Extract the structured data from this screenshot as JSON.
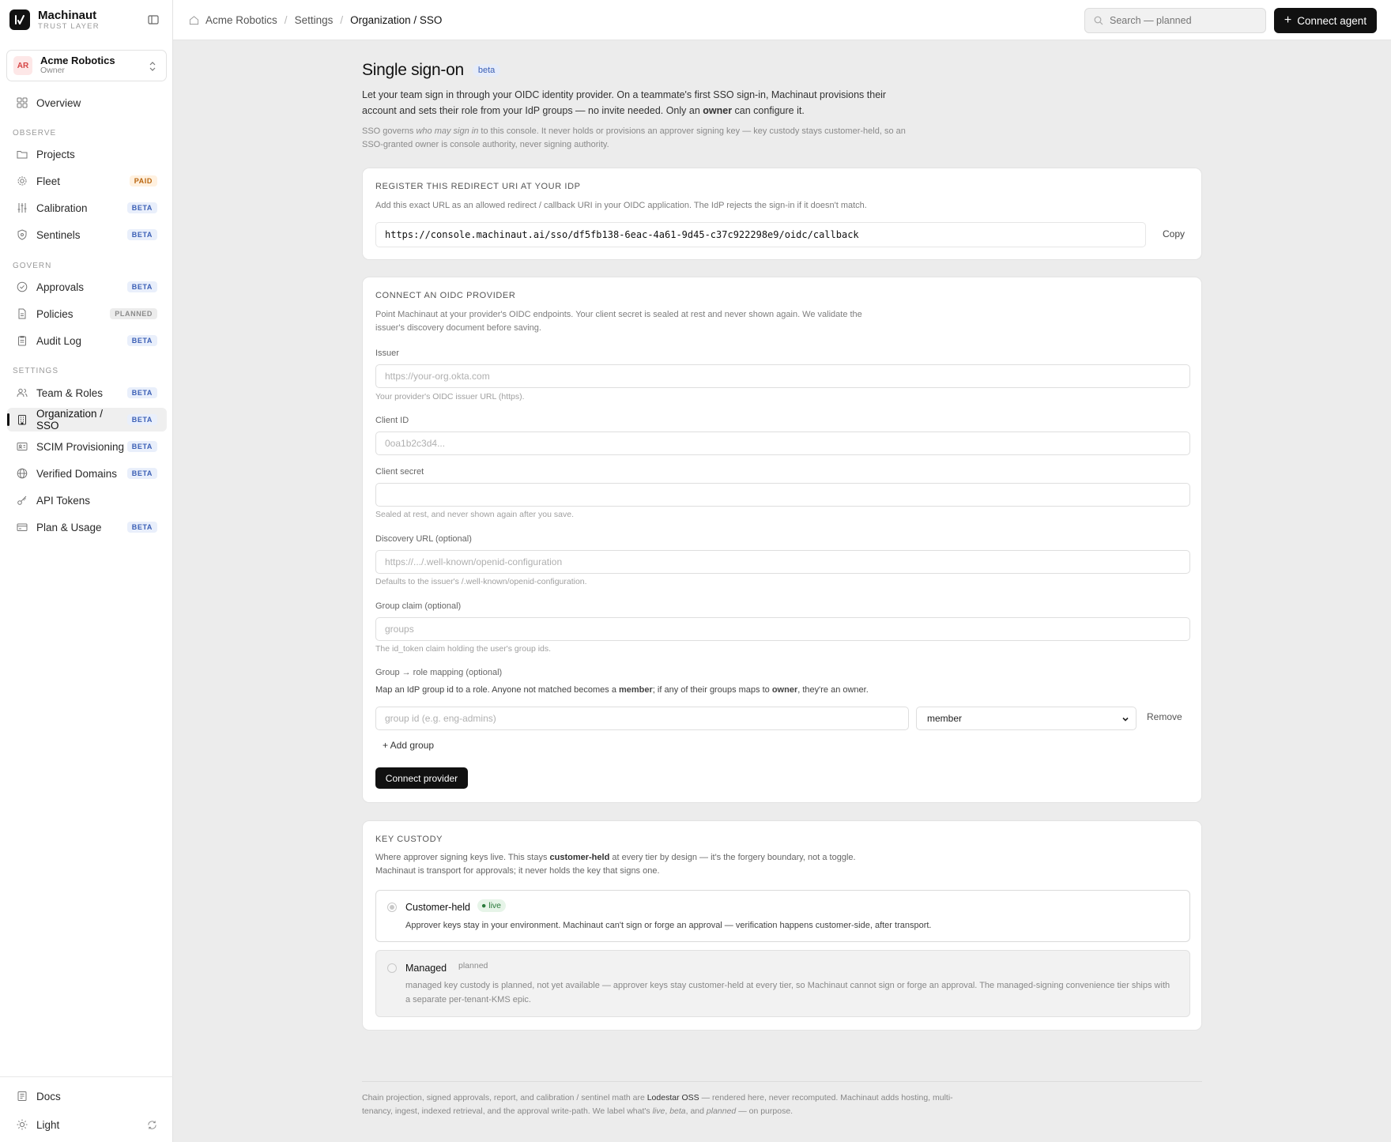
{
  "brand": {
    "name": "Machinaut",
    "sub": "TRUST LAYER"
  },
  "org": {
    "initials": "AR",
    "name": "Acme Robotics",
    "role": "Owner"
  },
  "nav": {
    "overview": "Overview",
    "observe_label": "OBSERVE",
    "observe": [
      {
        "label": "Projects",
        "badge": ""
      },
      {
        "label": "Fleet",
        "badge": "PAID"
      },
      {
        "label": "Calibration",
        "badge": "BETA"
      },
      {
        "label": "Sentinels",
        "badge": "BETA"
      }
    ],
    "govern_label": "GOVERN",
    "govern": [
      {
        "label": "Approvals",
        "badge": "BETA"
      },
      {
        "label": "Policies",
        "badge": "PLANNED"
      },
      {
        "label": "Audit Log",
        "badge": "BETA"
      }
    ],
    "settings_label": "SETTINGS",
    "settings": [
      {
        "label": "Team & Roles",
        "badge": "BETA"
      },
      {
        "label": "Organization / SSO",
        "badge": "BETA"
      },
      {
        "label": "SCIM Provisioning",
        "badge": "BETA"
      },
      {
        "label": "Verified Domains",
        "badge": "BETA"
      },
      {
        "label": "API Tokens",
        "badge": ""
      },
      {
        "label": "Plan & Usage",
        "badge": "BETA"
      }
    ],
    "docs": "Docs",
    "theme": "Light"
  },
  "breadcrumb": [
    "Acme Robotics",
    "Settings",
    "Organization / SSO"
  ],
  "search": {
    "placeholder": "Search — planned"
  },
  "connect_agent": "Connect agent",
  "page": {
    "title": "Single sign-on",
    "beta": "beta",
    "intro_a": "Let your team sign in through your OIDC identity provider. On a teammate's first SSO sign-in, Machinaut provisions their account and sets their role from your IdP groups — no invite needed. Only an ",
    "intro_owner": "owner",
    "intro_b": " can configure it.",
    "note_a": "SSO governs ",
    "note_em": "who may sign in",
    "note_b": " to this console. It never holds or provisions an approver signing key — key custody stays customer-held, so an SSO-granted owner is console authority, never signing authority."
  },
  "redirect": {
    "title": "REGISTER THIS REDIRECT URI AT YOUR IDP",
    "desc": "Add this exact URL as an allowed redirect / callback URI in your OIDC application. The IdP rejects the sign-in if it doesn't match.",
    "uri": "https://console.machinaut.ai/sso/df5fb138-6eac-4a61-9d45-c37c922298e9/oidc/callback",
    "copy": "Copy"
  },
  "oidc": {
    "title": "CONNECT AN OIDC PROVIDER",
    "desc": "Point Machinaut at your provider's OIDC endpoints. Your client secret is sealed at rest and never shown again. We validate the issuer's discovery document before saving.",
    "issuer_label": "Issuer",
    "issuer_placeholder": "https://your-org.okta.com",
    "issuer_help": "Your provider's OIDC issuer URL (https).",
    "client_id_label": "Client ID",
    "client_id_placeholder": "0oa1b2c3d4...",
    "secret_label": "Client secret",
    "secret_help": "Sealed at rest, and never shown again after you save.",
    "discovery_label": "Discovery URL (optional)",
    "discovery_placeholder": "https://.../.well-known/openid-configuration",
    "discovery_help": "Defaults to the issuer's /.well-known/openid-configuration.",
    "claim_label": "Group claim (optional)",
    "claim_placeholder": "groups",
    "claim_help": "The id_token claim holding the user's group ids.",
    "mapping_label": "Group → role mapping (optional)",
    "mapping_a": "Map an IdP group id to a role. Anyone not matched becomes a ",
    "mapping_member": "member",
    "mapping_b": "; if any of their groups maps to ",
    "mapping_owner": "owner",
    "mapping_c": ", they're an owner.",
    "group_placeholder": "group id (e.g. eng-admins)",
    "role_value": "member",
    "remove": "Remove",
    "add_group": "+ Add group",
    "connect": "Connect provider"
  },
  "custody": {
    "title": "KEY CUSTODY",
    "desc_a": "Where approver signing keys live. This stays ",
    "desc_bold": "customer-held",
    "desc_b": " at every tier by design — it's the forgery boundary, not a toggle.",
    "desc_c": "Machinaut is transport for approvals; it never holds the key that signs one.",
    "customer_name": "Customer-held",
    "customer_tag": "live",
    "customer_desc": "Approver keys stay in your environment. Machinaut can't sign or forge an approval — verification happens customer-side, after transport.",
    "managed_name": "Managed",
    "managed_tag": "planned",
    "managed_desc": "managed key custody is planned, not yet available — approver keys stay customer-held at every tier, so Machinaut cannot sign or forge an approval. The managed-signing convenience tier ships with a separate per-tenant-KMS epic."
  },
  "footer": {
    "a": "Chain projection, signed approvals, report, and calibration / sentinel math are ",
    "oss": "Lodestar OSS",
    "b": " — rendered here, never recomputed. Machinaut adds hosting, multi-tenancy, ingest, indexed retrieval, and the approval write-path. We label what's ",
    "live": "live",
    "c": ", ",
    "beta": "beta",
    "d": ", and ",
    "planned": "planned",
    "e": " — on purpose."
  }
}
